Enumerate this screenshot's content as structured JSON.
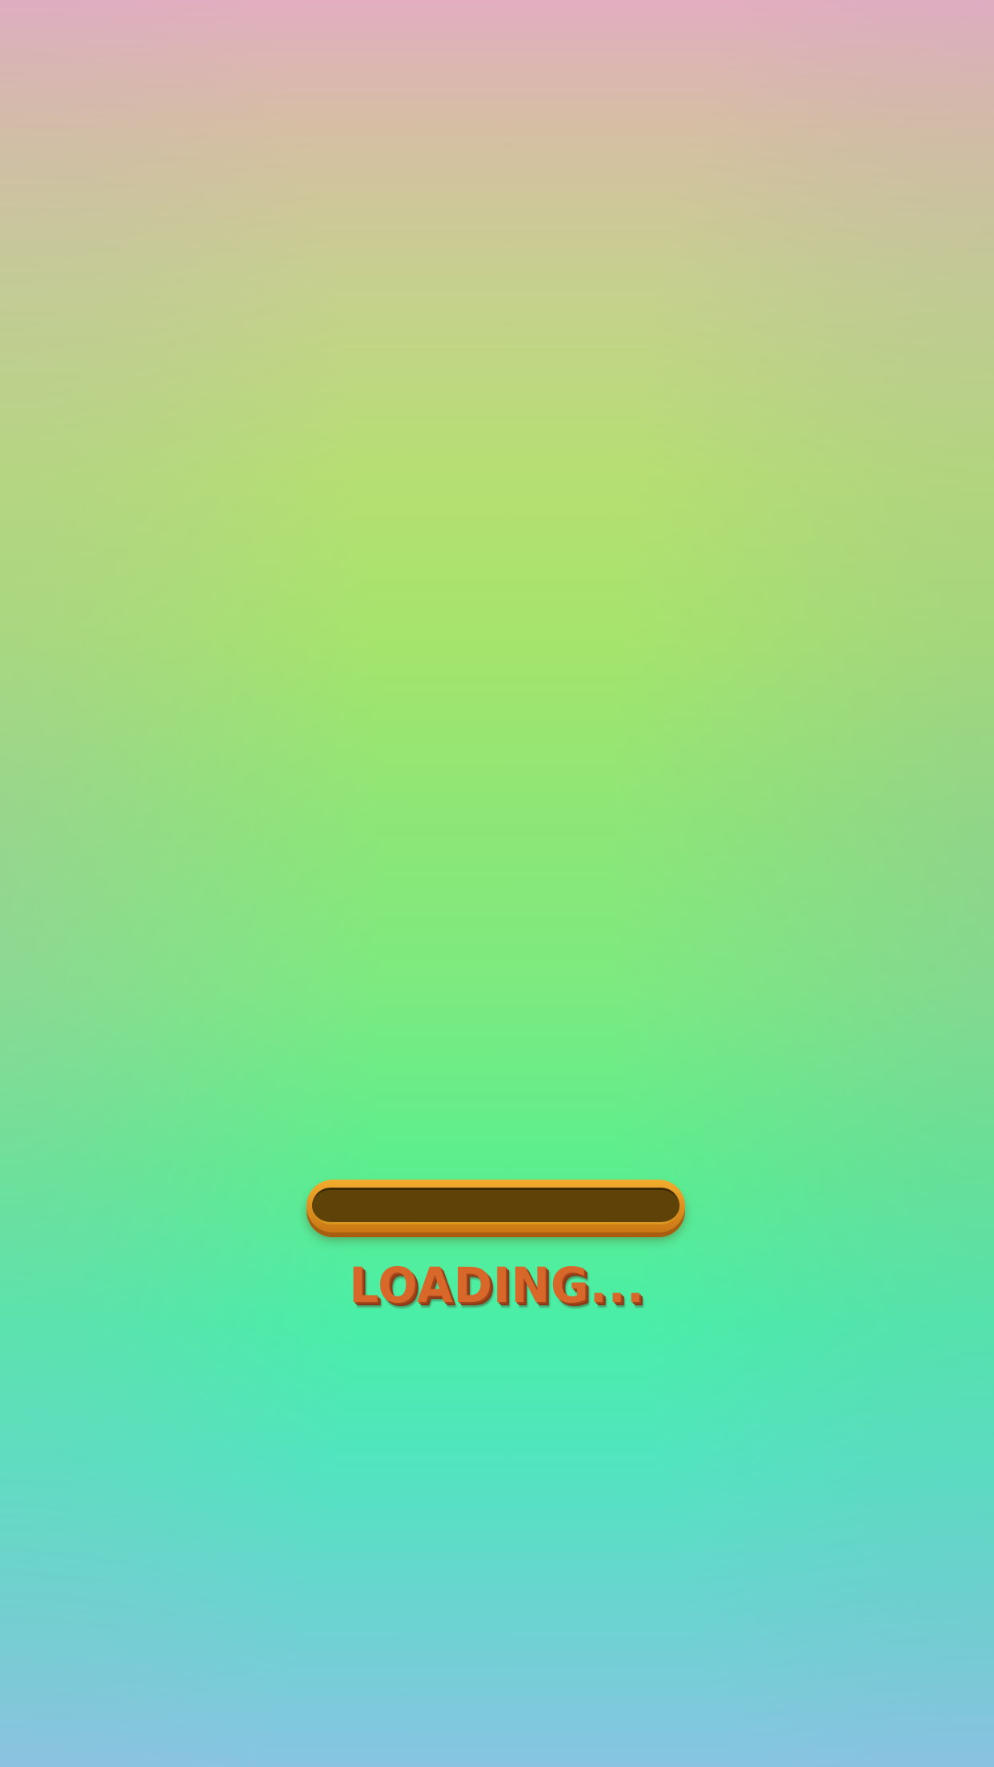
{
  "loading_screen": {
    "status_text": "LOADING...",
    "progress": 0
  },
  "colors": {
    "bar_frame": "#e09520",
    "bar_track": "#5e4207",
    "text": "#d8682a"
  }
}
